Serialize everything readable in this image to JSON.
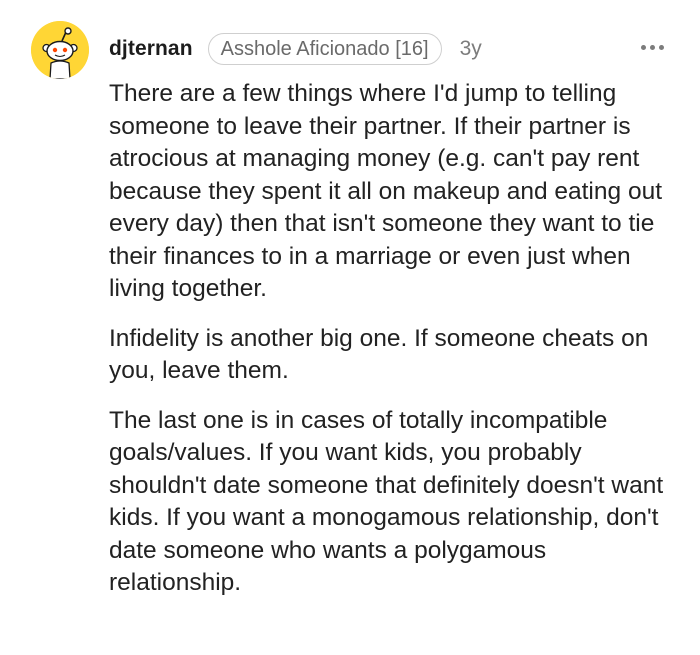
{
  "comment": {
    "author": "djternan",
    "flair": "Asshole Aficionado [16]",
    "age": "3y",
    "avatar_icon": "snoo-avatar-icon",
    "more_icon": "more-options-icon",
    "colors": {
      "avatar_bg": "#ffd635",
      "text": "#222222",
      "muted": "#7c7c7c"
    },
    "paragraphs": [
      "There are a few things where I'd jump to telling someone to leave their partner. If their partner is atrocious at managing money (e.g. can't pay rent because they spent it all on makeup and eating out every day) then that isn't someone they want to tie their finances to in a marriage or even just when living together.",
      "Infidelity is another big one. If someone cheats on you, leave them.",
      "The last one is in cases of totally incompatible goals/values. If you want kids, you probably shouldn't date someone that definitely doesn't want kids. If you want a monogamous relationship, don't date someone who wants a polygamous relationship."
    ]
  }
}
